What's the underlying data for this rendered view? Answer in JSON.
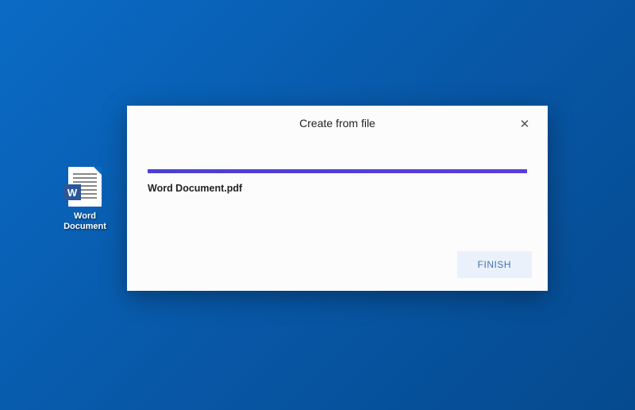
{
  "desktop": {
    "icon_label_line1": "Word",
    "icon_label_line2": "Document",
    "icon_badge": "W"
  },
  "dialog": {
    "title": "Create from file",
    "close_symbol": "✕",
    "file_name": "Word Document.pdf",
    "finish_label": "FINISH",
    "progress_percent": 100
  }
}
